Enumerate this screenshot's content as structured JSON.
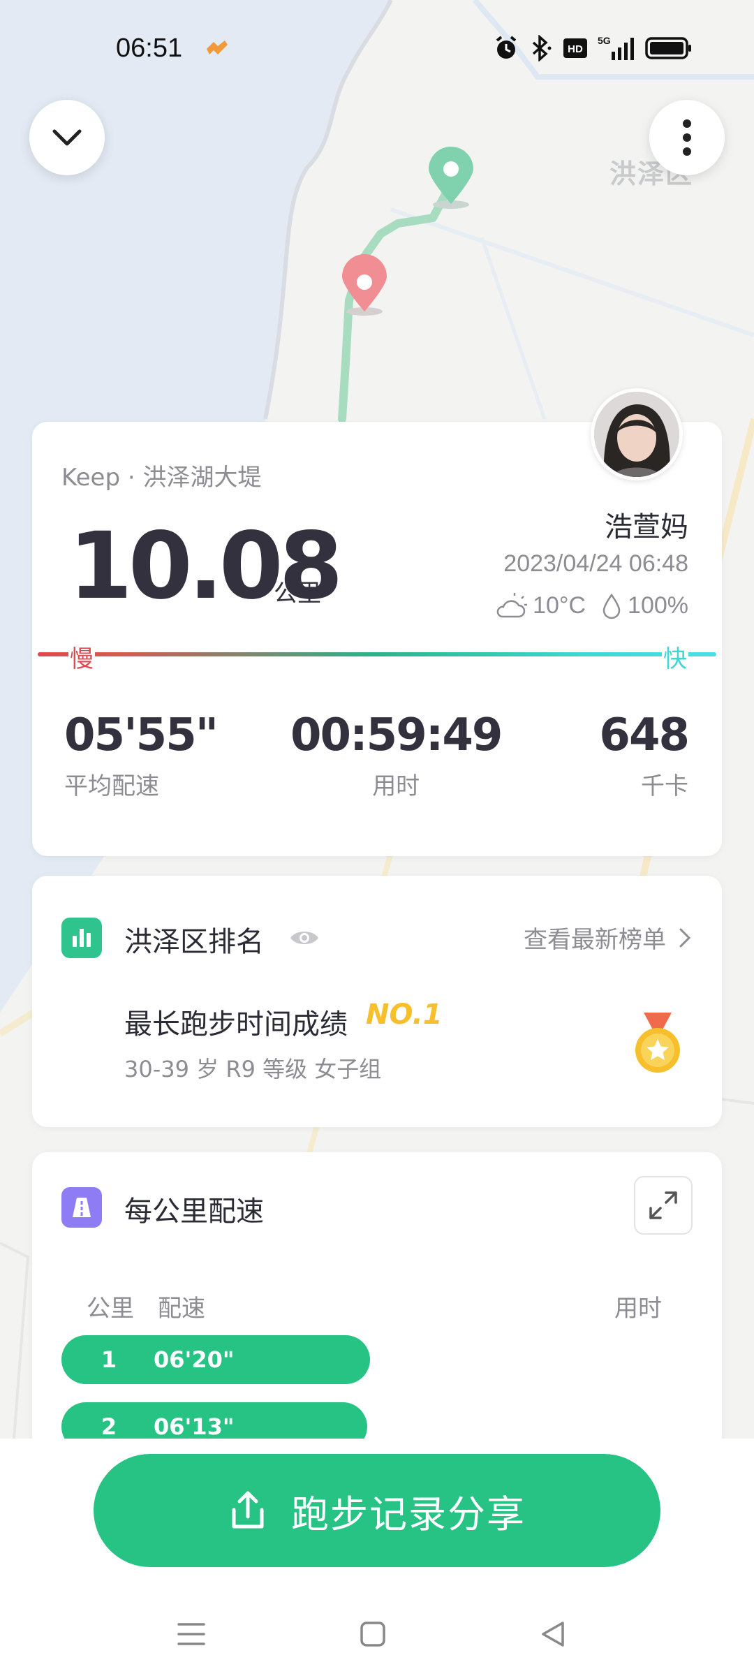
{
  "status_bar": {
    "time": "06:51",
    "network": "5G"
  },
  "map": {
    "district_label": "洪泽区"
  },
  "summary": {
    "location": "Keep · 洪泽湖大堤",
    "distance": "10.08",
    "distance_unit": "公里",
    "user_name": "浩萱妈",
    "datetime": "2023/04/24 06:48",
    "temperature": "10°C",
    "humidity": "100%",
    "slow_label": "慢",
    "fast_label": "快",
    "stats": [
      {
        "value": "05'55\"",
        "label": "平均配速"
      },
      {
        "value": "00:59:49",
        "label": "用时"
      },
      {
        "value": "648",
        "label": "千卡"
      }
    ]
  },
  "ranking": {
    "title": "洪泽区排名",
    "link_label": "查看最新榜单",
    "achievement": "最长跑步时间成绩",
    "rank": "NO.1",
    "group": "30-39 岁 R9 等级 女子组"
  },
  "pace": {
    "title": "每公里配速",
    "col_km": "公里",
    "col_pace": "配速",
    "col_time": "用时",
    "rows": [
      {
        "km": "1",
        "pace": "06'20\""
      },
      {
        "km": "2",
        "pace": "06'13\""
      }
    ]
  },
  "share": {
    "label": "跑步记录分享"
  },
  "colors": {
    "brand_green": "#26c384",
    "slow": "#e0494e",
    "fast": "#3ed7d2",
    "medal": "#f6bf2b"
  }
}
